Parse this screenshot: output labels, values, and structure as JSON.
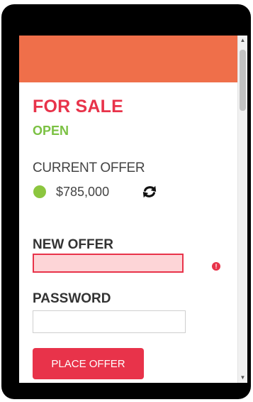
{
  "listing": {
    "sale_status": "FOR SALE",
    "open_status": "OPEN",
    "current_offer_label": "CURRENT OFFER",
    "current_offer_amount": "$785,000"
  },
  "form": {
    "new_offer_label": "NEW OFFER",
    "new_offer_value": "",
    "password_label": "PASSWORD",
    "password_value": "",
    "place_offer_label": "PLACE OFFER",
    "new_offer_error": "!"
  },
  "colors": {
    "header": "#ef6f4a",
    "accent_red": "#e8334a",
    "open_green": "#7bc143",
    "status_dot": "#8cc63f",
    "error_fill": "#fdd5d7"
  },
  "icons": {
    "status": "green-dot-icon",
    "refresh": "refresh-icon",
    "error": "error-icon",
    "scroll_up": "scroll-up-arrow-icon",
    "scroll_down": "scroll-down-arrow-icon"
  }
}
